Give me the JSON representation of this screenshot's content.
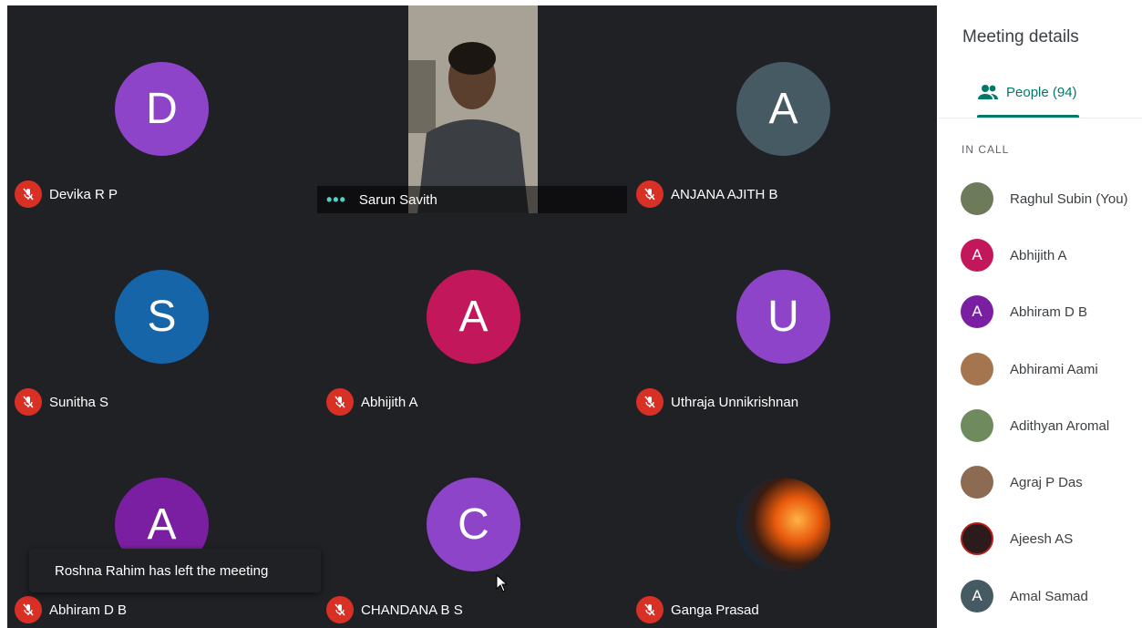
{
  "tiles": [
    {
      "name": "Devika R P",
      "initial": "D",
      "color": "#8e44c9"
    },
    {
      "name": "Sarun Savith",
      "initial": "",
      "color": ""
    },
    {
      "name": "ANJANA AJITH B",
      "initial": "A",
      "color": "#465a64"
    },
    {
      "name": "Sunitha S",
      "initial": "S",
      "color": "#1565a8"
    },
    {
      "name": "Abhijith A",
      "initial": "A",
      "color": "#c2185b"
    },
    {
      "name": "Uthraja Unnikrishnan",
      "initial": "U",
      "color": "#8e44c9"
    },
    {
      "name": "Abhiram D B",
      "initial": "A",
      "color": "#7b1fa2"
    },
    {
      "name": "CHANDANA B S",
      "initial": "C",
      "color": "#8e44c9"
    },
    {
      "name": "Ganga Prasad",
      "initial": "",
      "color": ""
    }
  ],
  "toast": "Roshna Rahim has left the meeting",
  "sidebar": {
    "title": "Meeting details",
    "people_tab": "People (94)",
    "section": "IN CALL",
    "people": [
      {
        "name": "Raghul Subin (You)",
        "initial": "",
        "color": "#6d7b5a"
      },
      {
        "name": "Abhijith A",
        "initial": "A",
        "color": "#c2185b"
      },
      {
        "name": "Abhiram D B",
        "initial": "A",
        "color": "#7b1fa2"
      },
      {
        "name": "Abhirami Aami",
        "initial": "",
        "color": "#a5754f"
      },
      {
        "name": "Adithyan Aromal",
        "initial": "",
        "color": "#6f8a5d"
      },
      {
        "name": "Agraj P Das",
        "initial": "",
        "color": "#8c6b52"
      },
      {
        "name": "Ajeesh AS",
        "initial": "",
        "color": "#2b1b1b"
      },
      {
        "name": "Amal Samad",
        "initial": "A",
        "color": "#465a64"
      }
    ]
  }
}
